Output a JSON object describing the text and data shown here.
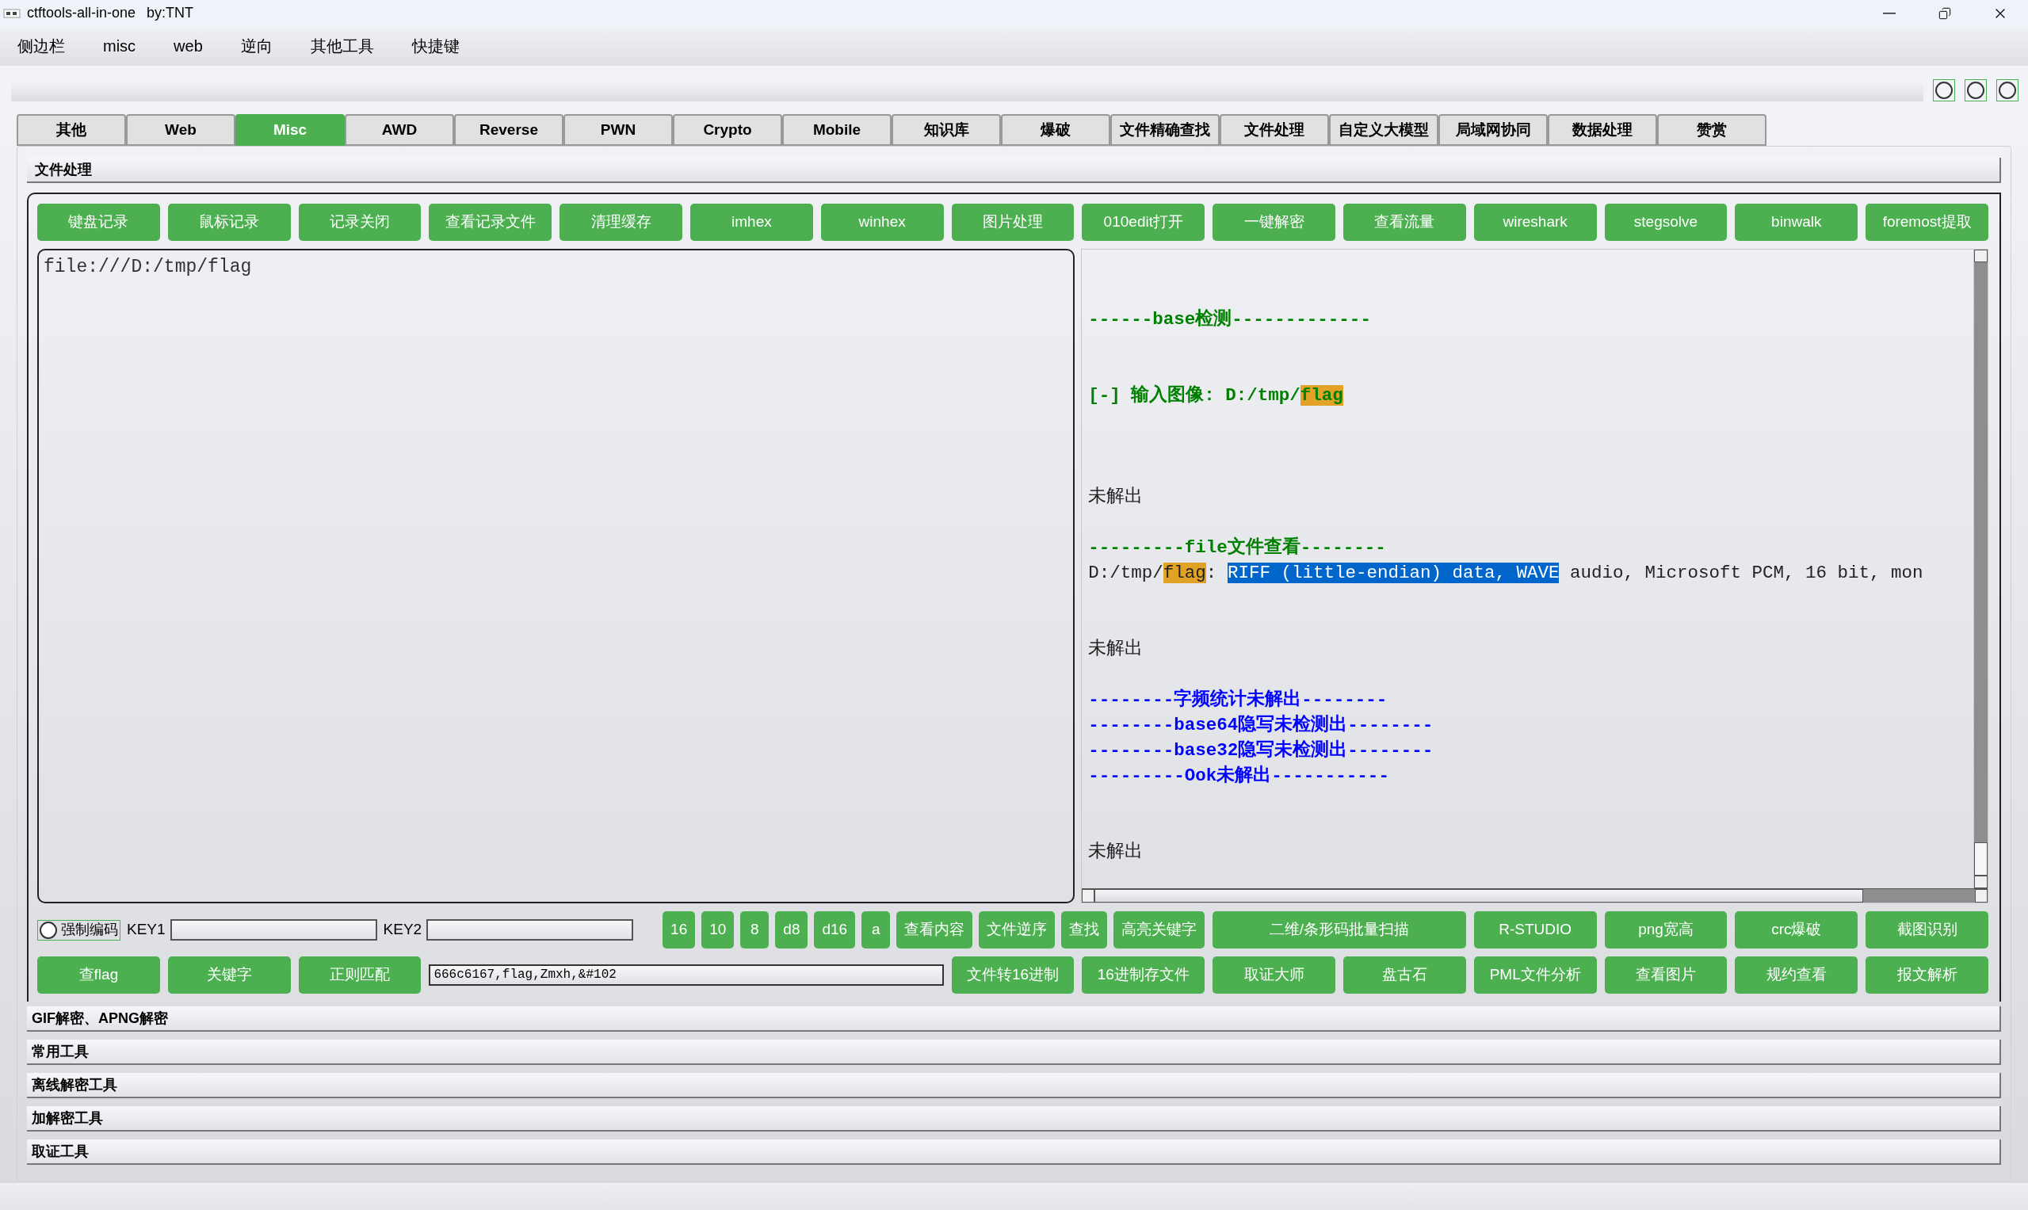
{
  "window": {
    "title": "ctftools-all-in-one",
    "author": "by:TNT"
  },
  "menu": [
    "侧边栏",
    "misc",
    "web",
    "逆向",
    "其他工具",
    "快捷键"
  ],
  "tabs": [
    {
      "label": "其他",
      "selected": false
    },
    {
      "label": "Web",
      "selected": false
    },
    {
      "label": "Misc",
      "selected": true
    },
    {
      "label": "AWD",
      "selected": false
    },
    {
      "label": "Reverse",
      "selected": false
    },
    {
      "label": "PWN",
      "selected": false
    },
    {
      "label": "Crypto",
      "selected": false
    },
    {
      "label": "Mobile",
      "selected": false
    },
    {
      "label": "知识库",
      "selected": false
    },
    {
      "label": "爆破",
      "selected": false
    },
    {
      "label": "文件精确查找",
      "selected": false
    },
    {
      "label": "文件处理",
      "selected": false
    },
    {
      "label": "自定义大模型",
      "selected": false
    },
    {
      "label": "局域网协同",
      "selected": false
    },
    {
      "label": "数据处理",
      "selected": false
    },
    {
      "label": "赞赏",
      "selected": false
    }
  ],
  "section": {
    "title": "文件处理"
  },
  "toolbar": [
    "键盘记录",
    "鼠标记录",
    "记录关闭",
    "查看记录文件",
    "清理缓存",
    "imhex",
    "winhex",
    "图片处理",
    "010edit打开",
    "一键解密",
    "查看流量",
    "wireshark",
    "stegsolve",
    "binwalk",
    "foremost提取"
  ],
  "input": {
    "value": "file:///D:/tmp/flag"
  },
  "output": {
    "lines": [
      {
        "kind": "blank"
      },
      {
        "kind": "blank"
      },
      {
        "kind": "green",
        "segments": [
          {
            "text": "------base检测-------------",
            "highlighted": false,
            "selected": false
          }
        ]
      },
      {
        "kind": "blank"
      },
      {
        "kind": "blank"
      },
      {
        "kind": "green",
        "segments": [
          {
            "text": "[-] 输入图像: D:/tmp/",
            "highlighted": false,
            "selected": false
          },
          {
            "text": "flag",
            "highlighted": true,
            "selected": false
          }
        ]
      },
      {
        "kind": "blank"
      },
      {
        "kind": "blank"
      },
      {
        "kind": "blank"
      },
      {
        "kind": "plain",
        "segments": [
          {
            "text": "未解出",
            "highlighted": false,
            "selected": false
          }
        ]
      },
      {
        "kind": "blank"
      },
      {
        "kind": "green",
        "segments": [
          {
            "text": "---------file文件查看--------",
            "highlighted": false,
            "selected": false
          }
        ]
      },
      {
        "kind": "plain",
        "segments": [
          {
            "text": "D:/tmp/",
            "highlighted": false,
            "selected": false
          },
          {
            "text": "flag",
            "highlighted": true,
            "selected": false
          },
          {
            "text": ": ",
            "highlighted": false,
            "selected": false
          },
          {
            "text": "RIFF (little-endian) data, WAVE",
            "highlighted": false,
            "selected": true
          },
          {
            "text": " audio, Microsoft PCM, 16 bit, mon",
            "highlighted": false,
            "selected": false
          }
        ]
      },
      {
        "kind": "blank"
      },
      {
        "kind": "blank"
      },
      {
        "kind": "plain",
        "segments": [
          {
            "text": "未解出",
            "highlighted": false,
            "selected": false
          }
        ]
      },
      {
        "kind": "blank"
      },
      {
        "kind": "blue",
        "segments": [
          {
            "text": "--------字频统计未解出--------",
            "highlighted": false,
            "selected": false
          }
        ]
      },
      {
        "kind": "blue",
        "segments": [
          {
            "text": "--------base64隐写未检测出--------",
            "highlighted": false,
            "selected": false
          }
        ]
      },
      {
        "kind": "blue",
        "segments": [
          {
            "text": "--------base32隐写未检测出--------",
            "highlighted": false,
            "selected": false
          }
        ]
      },
      {
        "kind": "blue",
        "segments": [
          {
            "text": "---------Ook未解出-----------",
            "highlighted": false,
            "selected": false
          }
        ]
      },
      {
        "kind": "blank"
      },
      {
        "kind": "blank"
      },
      {
        "kind": "plain",
        "segments": [
          {
            "text": "未解出",
            "highlighted": false,
            "selected": false
          }
        ]
      }
    ]
  },
  "force_encoding": {
    "label": "强制编码",
    "checked": false
  },
  "key1_label": "KEY1",
  "key2_label": "KEY2",
  "row2_buttons": [
    "16",
    "10",
    "8",
    "d8",
    "d16",
    "a",
    "查看内容",
    "文件逆序",
    "查找",
    "高亮关键字"
  ],
  "row2_wide_button": "二维/条形码批量扫描",
  "row2_right_buttons": [
    "R-STUDIO",
    "png宽高",
    "crc爆破",
    "截图识别"
  ],
  "row3_left_buttons": [
    "查flag",
    "关键字",
    "正则匹配"
  ],
  "keywords": {
    "value": "666c6167,flag,Zmxh,&#102"
  },
  "row3_right_buttons": [
    "文件转16进制",
    "16进制存文件",
    "取证大师",
    "盘古石",
    "PML文件分析",
    "查看图片",
    "规约查看",
    "报文解析"
  ],
  "other_sections": [
    {
      "title": "GIF解密、APNG解密"
    },
    {
      "title": "常用工具"
    },
    {
      "title": "离线解密工具"
    },
    {
      "title": "加解密工具"
    },
    {
      "title": "取证工具"
    }
  ]
}
